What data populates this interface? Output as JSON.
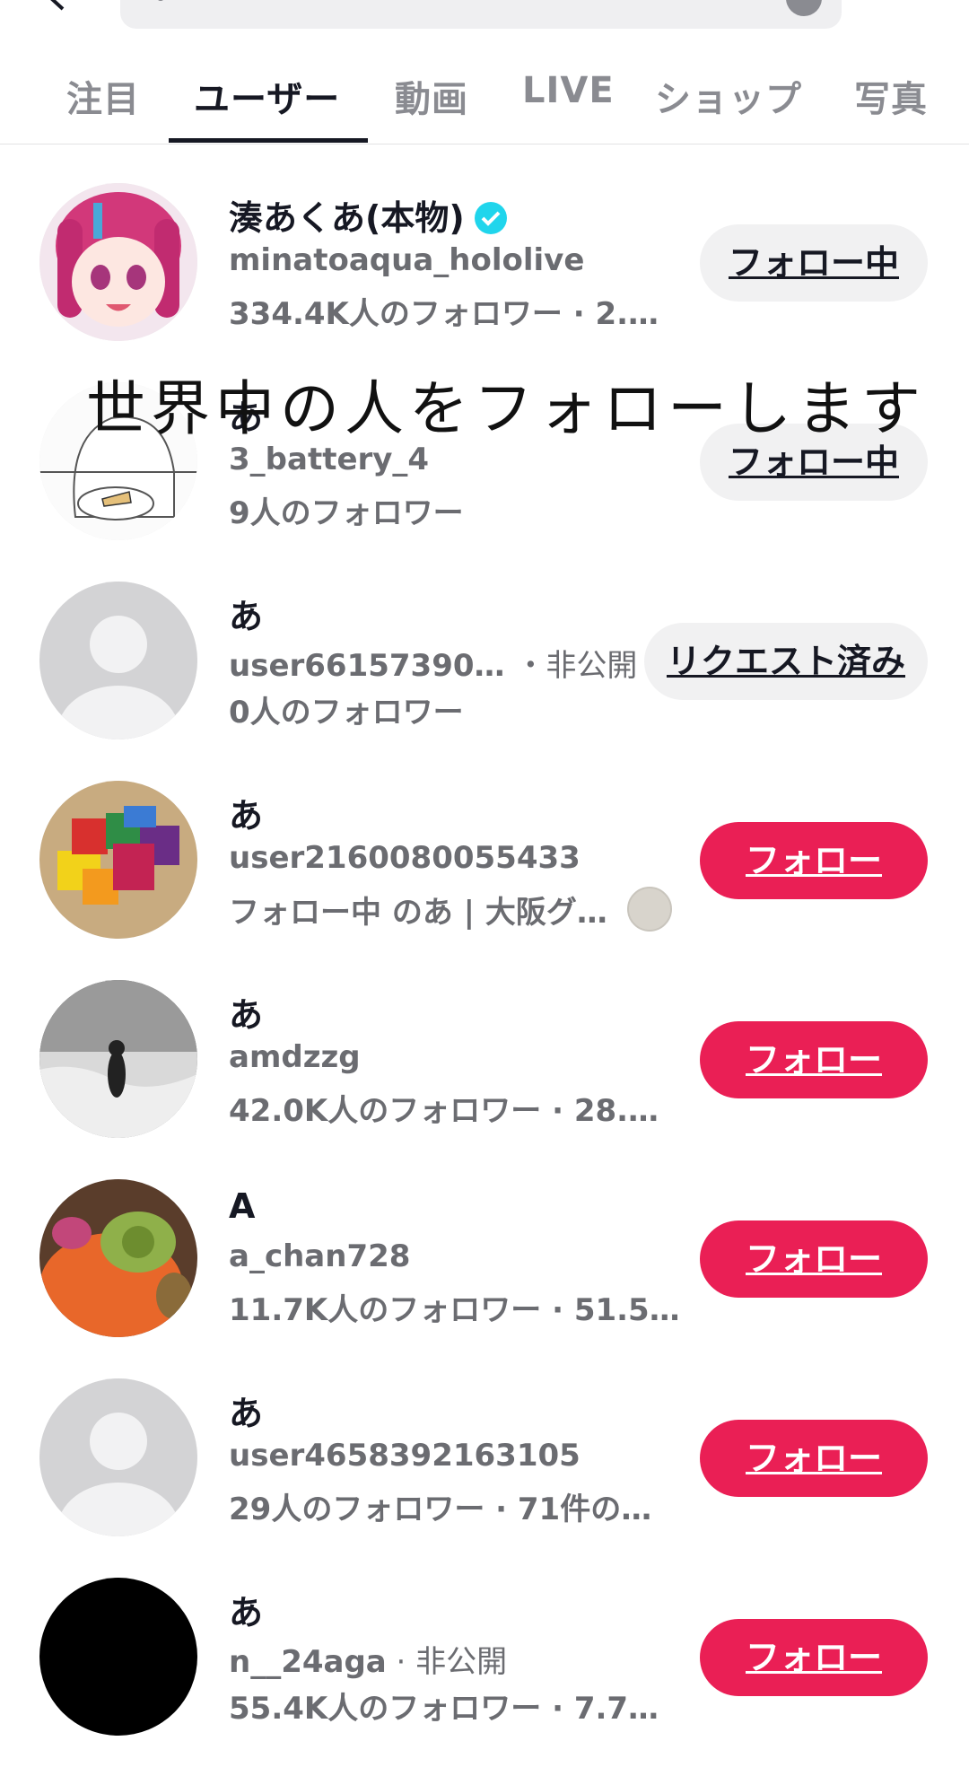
{
  "tabs": [
    {
      "label": "注目",
      "active": false
    },
    {
      "label": "ユーザー",
      "active": true
    },
    {
      "label": "動画",
      "active": false
    },
    {
      "label": "LIVE",
      "active": false
    },
    {
      "label": "ショップ",
      "active": false
    },
    {
      "label": "写真",
      "active": false
    }
  ],
  "overlay_text": "世界中の人をフォローします",
  "colors": {
    "follow_red": "#ea1f55",
    "verified_cyan": "#20d5ec",
    "muted_text": "#6b6c71"
  },
  "users": [
    {
      "name": "湊あくあ(本物)",
      "verified": true,
      "handle": "minatoaqua_hololive",
      "meta": "334.4K人のフォロワー · 2.…",
      "button": "フォロー中"
    },
    {
      "name": "あ",
      "handle": "3_battery_4",
      "meta": "9人のフォロワー",
      "button": "フォロー中"
    },
    {
      "name": "あ",
      "handle": "user66157390…",
      "private": "・非公開",
      "meta": "0人のフォロワー",
      "button": "リクエスト済み"
    },
    {
      "name": "あ",
      "handle": "user2160080055433",
      "meta": "フォロー中 のあ | 大阪グ…",
      "button": "フォロー"
    },
    {
      "name": "あ",
      "handle": "amdzzg",
      "meta": "42.0K人のフォロワー · 28.…",
      "button": "フォロー"
    },
    {
      "name": "A",
      "handle": "a_chan728",
      "meta": "11.7K人のフォロワー · 51.5…",
      "button": "フォロー"
    },
    {
      "name": "あ",
      "handle": "user4658392163105",
      "meta": "29人のフォロワー · 71件の…",
      "button": "フォロー"
    },
    {
      "name": "あ",
      "handle": "n__24aga",
      "private": " · 非公開",
      "meta": "55.4K人のフォロワー · 7.7…",
      "button": "フォロー"
    }
  ]
}
